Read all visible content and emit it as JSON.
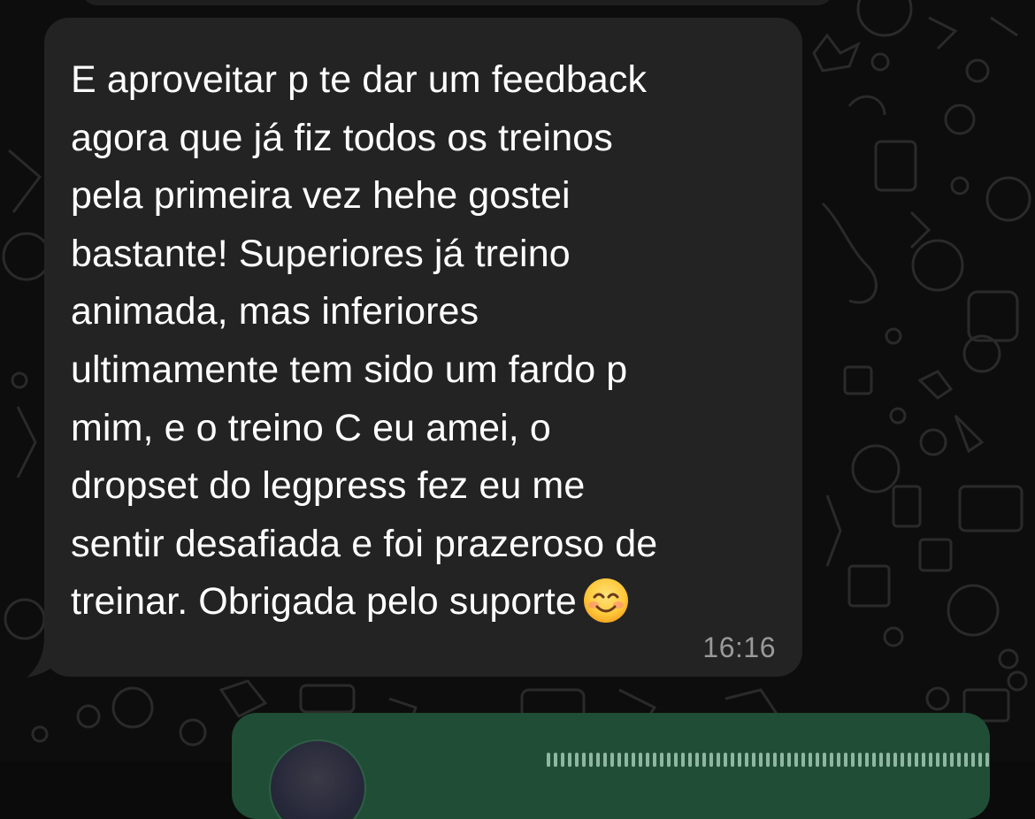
{
  "chat": {
    "incoming_message": {
      "text": "E aproveitar p te dar um feedback\nagora que já fiz todos os treinos\npela primeira vez hehe gostei\nbastante! Superiores já treino\nanimada, mas inferiores\nultimamente tem sido um fardo p\nmim, e o treino C eu amei, o\ndropset do legpress fez eu me\nsentir desafiada e foi prazeroso de\ntreinar. Obrigada pelo suporte",
      "emoji": "smiling-face-with-smiling-eyes",
      "time": "16:16"
    },
    "outgoing_message": {
      "type": "voice-note"
    }
  },
  "colors": {
    "background": "#0d0d0d",
    "incoming_bubble": "#232323",
    "outgoing_bubble": "#1f4d35",
    "text": "#ffffff",
    "timestamp": "#9a9a9a"
  }
}
